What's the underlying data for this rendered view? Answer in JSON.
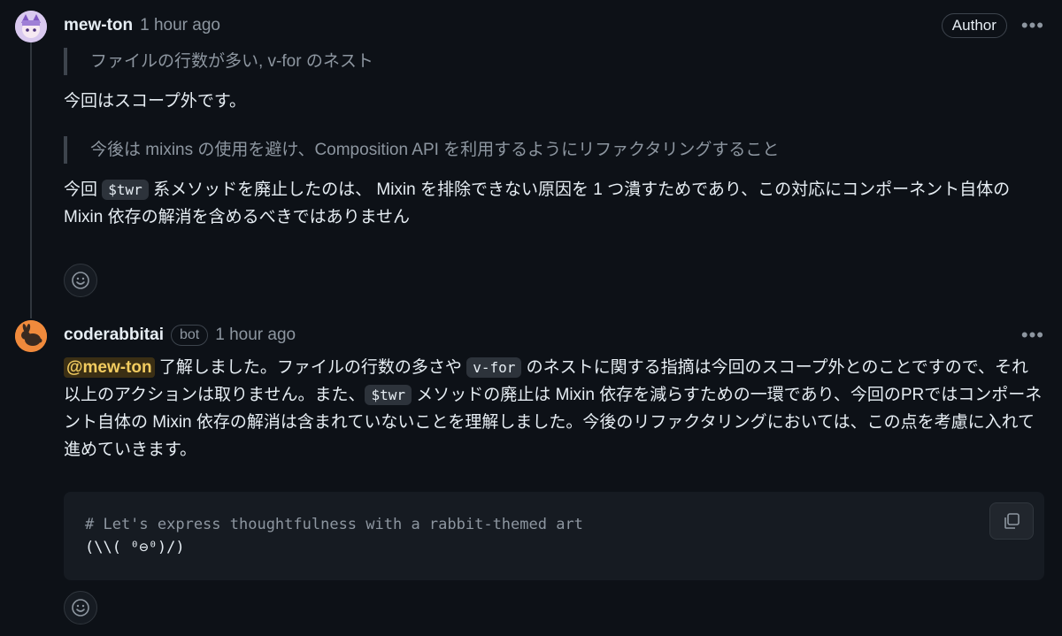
{
  "comments": [
    {
      "author": "mew-ton",
      "time": "1 hour ago",
      "role_badge": "Author",
      "menu_icon": "kebab-icon",
      "avatar_icon": "user-avatar",
      "quote1": "ファイルの行数が多い, v-for のネスト",
      "para1": "今回はスコープ外です。",
      "quote2": "今後は mixins の使用を避け、Composition API を利用するようにリファクタリングすること",
      "para2_a": "今回 ",
      "para2_code": "$twr",
      "para2_b": " 系メソッドを廃止したのは、 Mixin を排除できない原因を 1 つ潰すためであり、この対応にコンポーネント自体の Mixin 依存の解消を含めるべきではありません",
      "reaction_icon": "smiley-icon"
    },
    {
      "author": "coderabbitai",
      "bot_badge": "bot",
      "time": "1 hour ago",
      "menu_icon": "kebab-icon",
      "avatar_icon": "rabbit-icon",
      "mention": "@mew-ton",
      "text_a": " 了解しました。ファイルの行数の多さや ",
      "code_a": "v-for",
      "text_b": " のネストに関する指摘は今回のスコープ外とのことですので、それ以上のアクションは取りません。また、",
      "code_b": "$twr",
      "text_c": " メソッドの廃止は Mixin 依存を減らすための一環であり、今回のPRではコンポーネント自体の Mixin 依存の解消は含まれていないことを理解しました。今後のリファクタリングにおいては、この点を考慮に入れて進めていきます。",
      "code_block_line1": "# Let's express thoughtfulness with a rabbit-themed art",
      "code_block_line2": "(\\\\( ⁰⊖⁰)/)",
      "copy_icon": "copy-icon",
      "reaction_icon": "smiley-icon"
    }
  ],
  "colors": {
    "background": "#0d1117",
    "text": "#e6edf3",
    "muted": "#8d96a0",
    "mention_bg": "#3b2f14",
    "mention_fg": "#f2cc60"
  }
}
